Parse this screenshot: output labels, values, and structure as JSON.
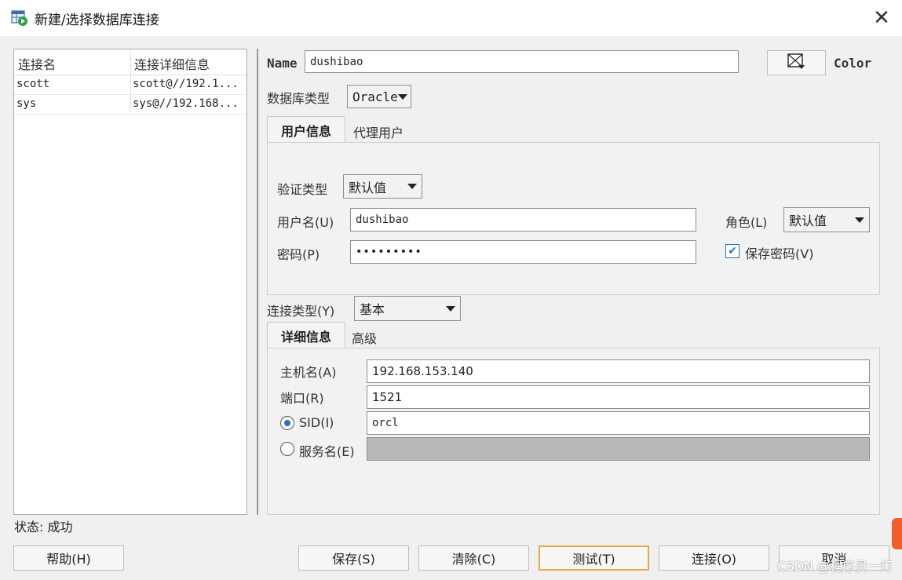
{
  "window": {
    "title": "新建/选择数据库连接",
    "close_icon": "✕"
  },
  "list": {
    "headers": [
      "连接名",
      "连接详细信息"
    ],
    "rows": [
      {
        "name": "scott",
        "details": "scott@//192.1..."
      },
      {
        "name": "sys",
        "details": "sys@//192.168..."
      }
    ]
  },
  "status": "状态: 成功",
  "form": {
    "name_label": "Name",
    "name_value": "dushibao",
    "color_label": "Color",
    "db_type_label": "数据库类型",
    "db_type_value": "Oracle",
    "tabs": {
      "user_info": "用户信息",
      "proxy_user": "代理用户"
    },
    "auth_type_label": "验证类型",
    "auth_type_value": "默认值",
    "username_label": "用户名(U)",
    "username_value": "dushibao",
    "role_label": "角色(L)",
    "role_value": "默认值",
    "password_label": "密码(P)",
    "password_value": "•••••••••",
    "save_password_label": "保存密码(V)",
    "save_password_checked": true,
    "conn_type_label": "连接类型(Y)",
    "conn_type_value": "基本",
    "detail_tabs": {
      "details": "详细信息",
      "advanced": "高级"
    },
    "host_label": "主机名(A)",
    "host_value": "192.168.153.140",
    "port_label": "端口(R)",
    "port_value": "1521",
    "sid_label": "SID(I)",
    "sid_value": "orcl",
    "service_label": "服务名(E)",
    "service_value": ""
  },
  "buttons": {
    "help": "帮助(H)",
    "save": "保存(S)",
    "clear": "清除(C)",
    "test": "测试(T)",
    "connect": "连接(O)",
    "cancel": "取消"
  },
  "watermark": "CSDN @程序员一灯",
  "colors": {
    "accent": "#2a6fc9",
    "focus": "#e8a84a",
    "disabled_field": "#b8b8b8"
  }
}
